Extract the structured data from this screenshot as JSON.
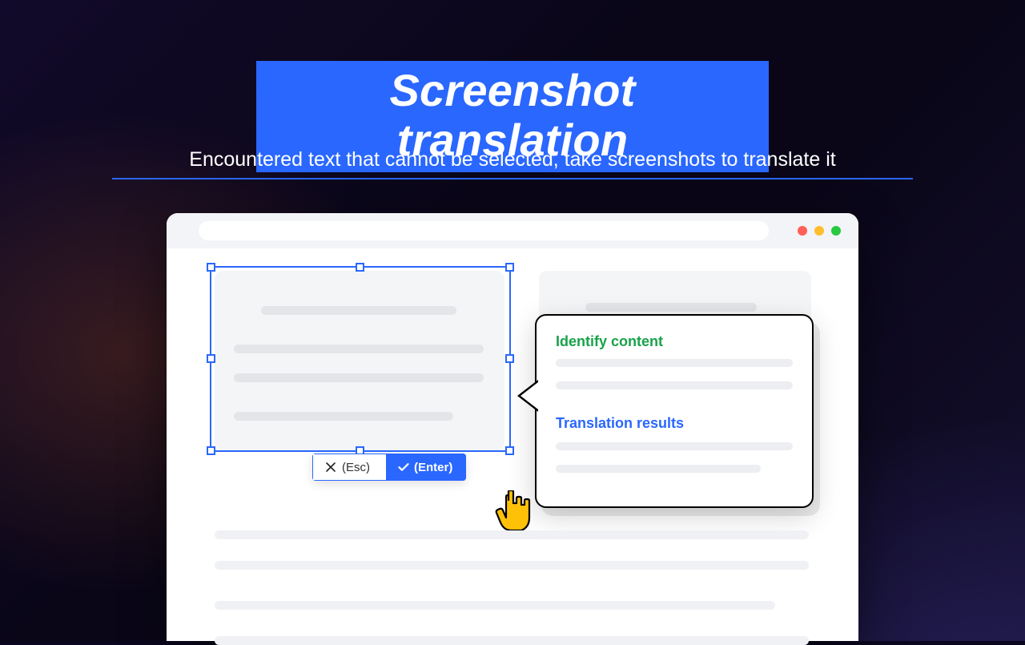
{
  "hero": {
    "title": "Screenshot translation",
    "subtitle": "Encountered text that cannot be selected, take screenshots to translate it"
  },
  "selection_toolbar": {
    "cancel_label": "(Esc)",
    "confirm_label": "(Enter)"
  },
  "popover": {
    "identify_label": "Identify content",
    "results_label": "Translation results"
  },
  "colors": {
    "accent": "#2a67ff",
    "identify": "#18a34a"
  }
}
